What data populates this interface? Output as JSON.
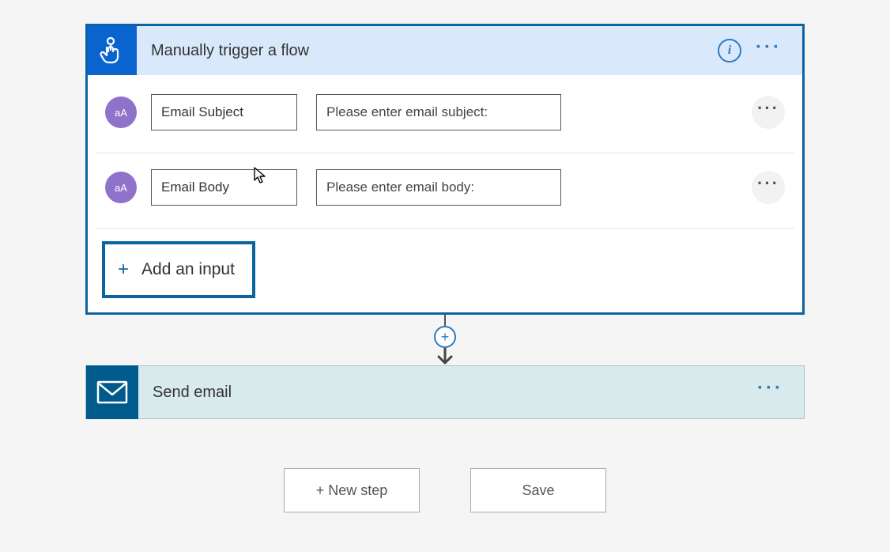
{
  "trigger": {
    "title": "Manually trigger a flow",
    "inputs": [
      {
        "name": "Email Subject",
        "prompt": "Please enter email subject:"
      },
      {
        "name": "Email Body",
        "prompt": "Please enter email body:"
      }
    ],
    "add_input_label": "Add an input"
  },
  "action": {
    "title": "Send email"
  },
  "footer": {
    "new_step": "+ New step",
    "save": "Save"
  },
  "icons": {
    "aa": "aA"
  }
}
